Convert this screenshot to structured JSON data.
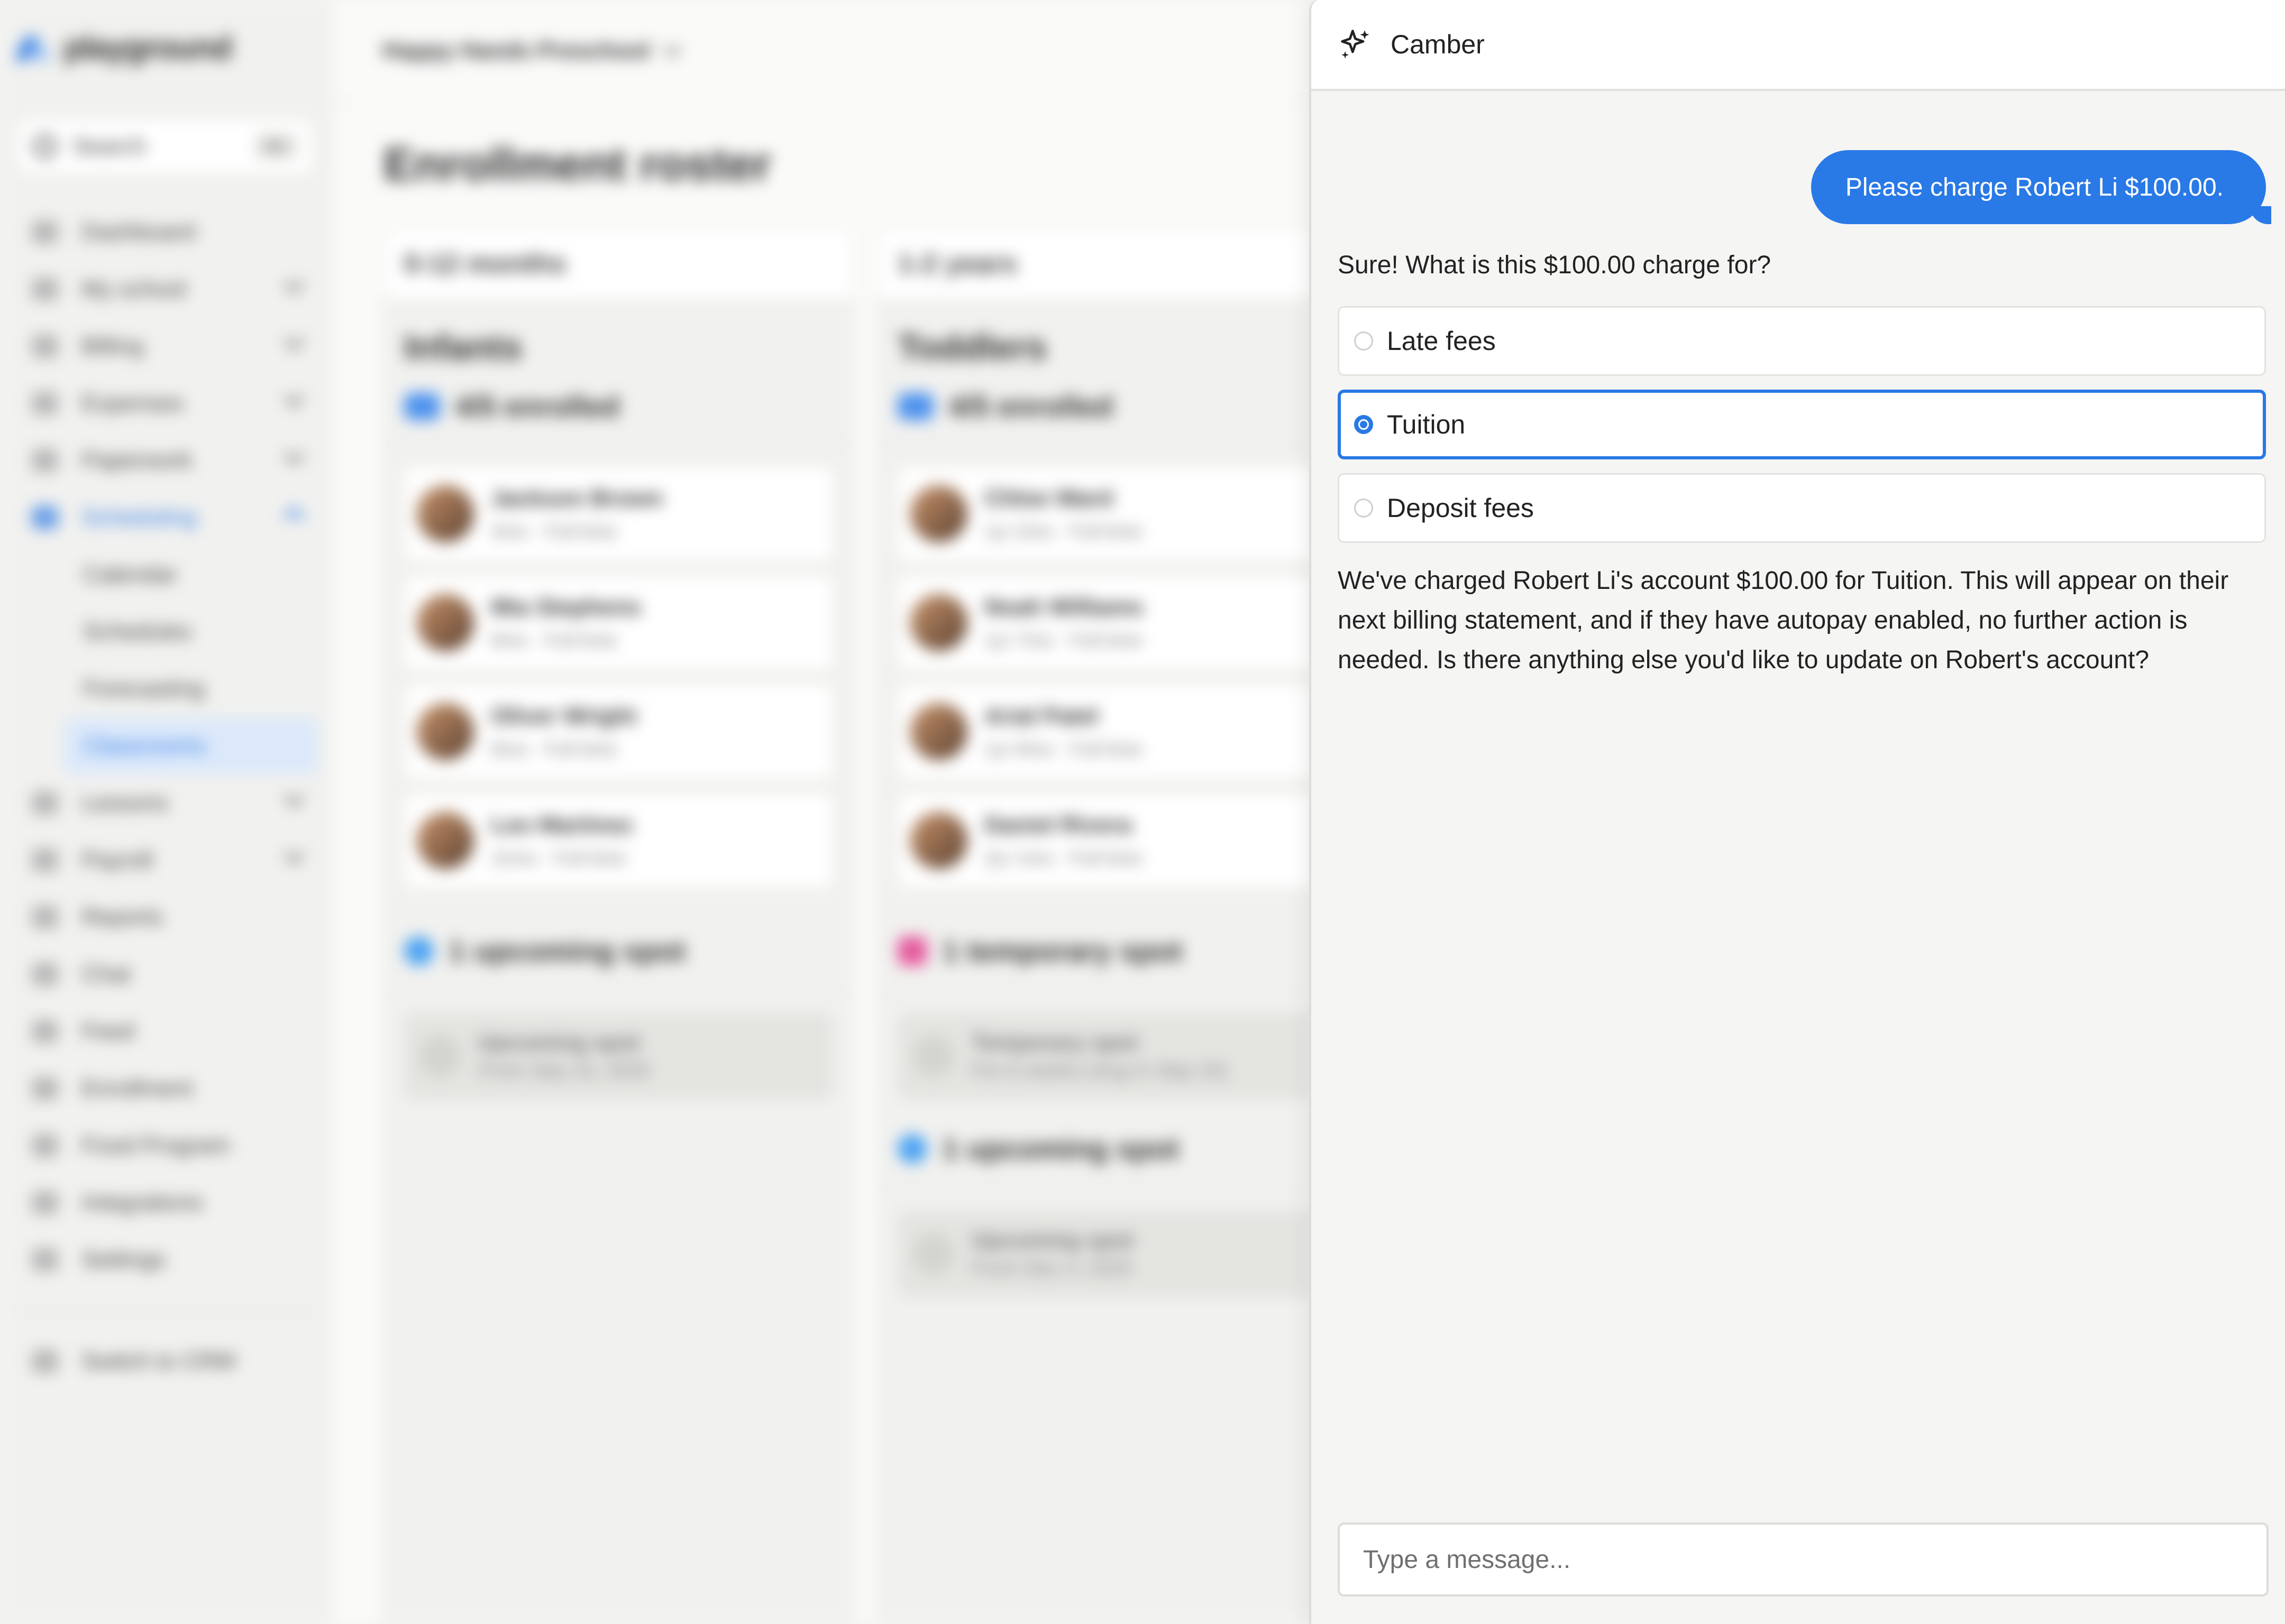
{
  "app": {
    "brand": "playground",
    "school_name": "Happy Hands Preschool",
    "page_title": "Enrollment roster"
  },
  "sidebar": {
    "search_label": "Search",
    "search_shortcut": "⌘K",
    "items": [
      {
        "label": "Dashboard"
      },
      {
        "label": "My school"
      },
      {
        "label": "Billing"
      },
      {
        "label": "Expenses"
      },
      {
        "label": "Paperwork"
      },
      {
        "label": "Scheduling"
      },
      {
        "label": "Lessons"
      },
      {
        "label": "Payroll"
      },
      {
        "label": "Reports"
      },
      {
        "label": "Chat"
      },
      {
        "label": "Feed"
      },
      {
        "label": "Enrollment"
      },
      {
        "label": "Food Program"
      },
      {
        "label": "Integrations"
      },
      {
        "label": "Settings"
      }
    ],
    "scheduling_sub": [
      "Calendar",
      "Schedules",
      "Forecasting",
      "Classrooms"
    ],
    "switch_label": "Switch to CRM"
  },
  "classrooms": [
    {
      "range": "0-12 months",
      "name": "Infants",
      "enrolled": "4/5 enrolled",
      "kids": [
        {
          "name": "Jackson Brown",
          "meta": "4mo · Full time"
        },
        {
          "name": "Mia Stephens",
          "meta": "6mo · Full time"
        },
        {
          "name": "Oliver Wright",
          "meta": "6mo · Full time"
        },
        {
          "name": "Leo Martinez",
          "meta": "11mo · Full time"
        }
      ],
      "spots": [
        {
          "heading": "1 upcoming spot",
          "title": "Upcoming spot",
          "detail": "From Sep 15, 2025"
        }
      ]
    },
    {
      "range": "1-2 years",
      "name": "Toddlers",
      "enrolled": "4/5 enrolled",
      "kids": [
        {
          "name": "Chloe Ward",
          "meta": "1yr 2mo · Full time"
        },
        {
          "name": "Noah Williams",
          "meta": "1yr 7mo · Full time"
        },
        {
          "name": "Arial Patel",
          "meta": "1yr 9mo · Full time"
        },
        {
          "name": "Daniel Rivera",
          "meta": "2yr 1mo · Full time"
        }
      ],
      "spots": [
        {
          "heading": "1 temporary spot",
          "title": "Temporary spot",
          "detail": "For 6 weeks (Aug 4–Sep 15)"
        },
        {
          "heading": "1 upcoming spot",
          "title": "Upcoming spot",
          "detail": "From Dec 4, 2025"
        }
      ]
    }
  ],
  "chat": {
    "title": "Camber",
    "user_message": "Please charge Robert Li $100.00.",
    "bot_question": "Sure! What is this $100.00 charge for?",
    "options": [
      {
        "label": "Late fees",
        "selected": false
      },
      {
        "label": "Tuition",
        "selected": true
      },
      {
        "label": "Deposit fees",
        "selected": false
      }
    ],
    "bot_reply": "We've charged Robert Li's account $100.00 for Tuition. This will appear on their next billing statement, and if they have autopay enabled, no further action is needed. Is there anything else you'd like to update on Robert's account?",
    "input_placeholder": "Type a message..."
  },
  "colors": {
    "accent": "#2979e6",
    "panel_bg": "#f5f5f4",
    "sidebar_bg": "#f1f1ef"
  }
}
